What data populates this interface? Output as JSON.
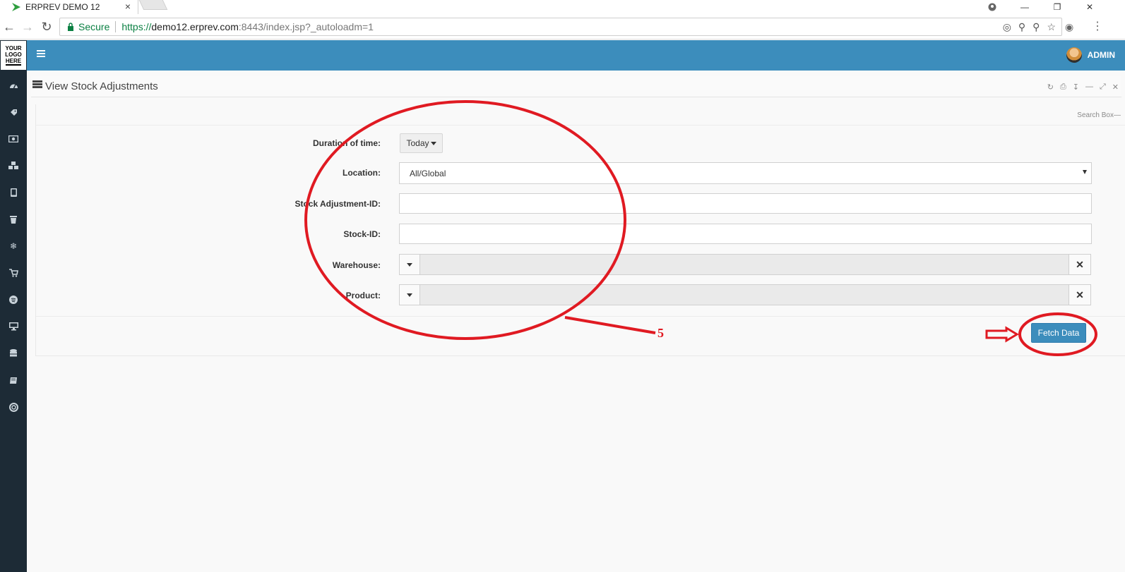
{
  "browser": {
    "tab_title": "ERPREV DEMO 12",
    "secure_label": "Secure",
    "url_proto": "https://",
    "url_host": "demo12.erprev.com",
    "url_rest": ":8443/index.jsp?_autoloadm=1"
  },
  "app": {
    "logo_line1": "YOUR",
    "logo_line2": "LOGO",
    "logo_line3": "HERE",
    "user_name": "ADMIN",
    "accent_color": "#3c8dbc",
    "sidebar_color": "#1d2b36"
  },
  "sidebar": {
    "icons": [
      "dashboard-icon",
      "tag-icon",
      "money-icon",
      "cubes-icon",
      "tablet-icon",
      "trash-icon",
      "snowflake-icon",
      "cart-icon",
      "spotify-icon",
      "desktop-icon",
      "database-icon",
      "book-icon",
      "lifebuoy-icon"
    ]
  },
  "panel": {
    "title": "View Stock Adjustments",
    "search_box_label": "Search Box"
  },
  "form": {
    "duration_label": "Duration of time:",
    "duration_value": "Today",
    "location_label": "Location:",
    "location_value": "All/Global",
    "stock_adjustment_id_label": "Stock Adjustment-ID:",
    "stock_id_label": "Stock-ID:",
    "warehouse_label": "Warehouse:",
    "product_label": "Product:",
    "fetch_button": "Fetch Data"
  },
  "annotation": {
    "number": "5",
    "color": "#e01a22"
  }
}
